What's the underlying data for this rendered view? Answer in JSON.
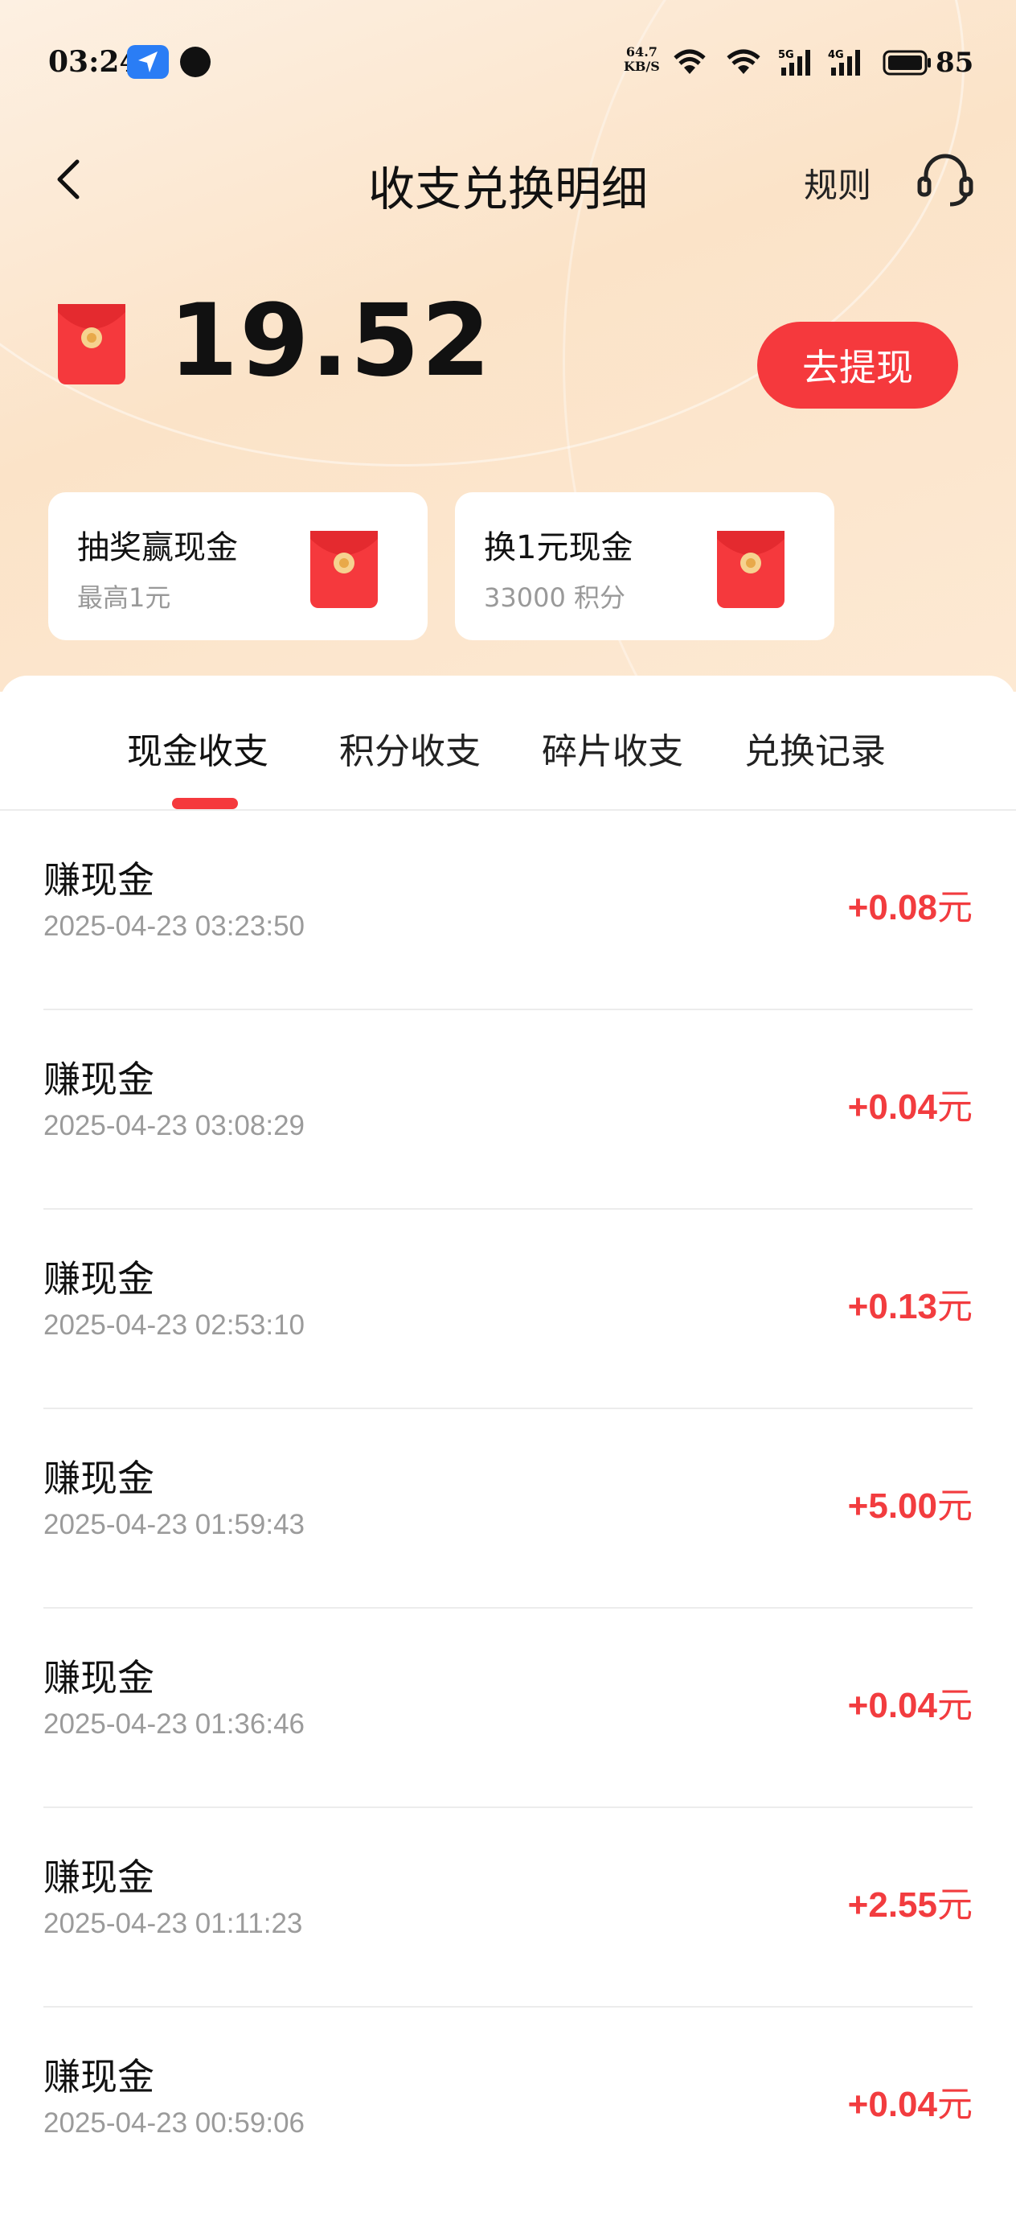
{
  "status_bar": {
    "time": "03:24",
    "net_speed_value": "64.7",
    "net_speed_unit": "KB/S",
    "sim1_label": "5G",
    "sim2_label": "4G",
    "battery": "85"
  },
  "header": {
    "title": "收支兑换明细",
    "rules_label": "规则"
  },
  "balance": {
    "amount": "19.52",
    "withdraw_label": "去提现"
  },
  "promos": [
    {
      "title": "抽奖赢现金",
      "subtitle": "最高1元"
    },
    {
      "title": "换1元现金",
      "subtitle": "33000 积分"
    }
  ],
  "tabs": [
    {
      "label": "现金收支",
      "active": true
    },
    {
      "label": "积分收支",
      "active": false
    },
    {
      "label": "碎片收支",
      "active": false
    },
    {
      "label": "兑换记录",
      "active": false
    }
  ],
  "transactions": [
    {
      "title": "赚现金",
      "time": "2025-04-23 03:23:50",
      "amount": "+0.08",
      "unit": "元"
    },
    {
      "title": "赚现金",
      "time": "2025-04-23 03:08:29",
      "amount": "+0.04",
      "unit": "元"
    },
    {
      "title": "赚现金",
      "time": "2025-04-23 02:53:10",
      "amount": "+0.13",
      "unit": "元"
    },
    {
      "title": "赚现金",
      "time": "2025-04-23 01:59:43",
      "amount": "+5.00",
      "unit": "元"
    },
    {
      "title": "赚现金",
      "time": "2025-04-23 01:36:46",
      "amount": "+0.04",
      "unit": "元"
    },
    {
      "title": "赚现金",
      "time": "2025-04-23 01:11:23",
      "amount": "+2.55",
      "unit": "元"
    },
    {
      "title": "赚现金",
      "time": "2025-04-23 00:59:06",
      "amount": "+0.04",
      "unit": "元"
    }
  ],
  "colors": {
    "accent_red": "#f5393d",
    "amount_red": "#f23c3f",
    "header_bg": "#fbe3c8",
    "location_badge": "#2a7df5"
  },
  "icons": [
    "location-arrow-icon",
    "chat-bubble-icon",
    "wifi-icon",
    "signal-icon",
    "battery-icon",
    "back-icon",
    "headset-icon",
    "red-envelope-icon"
  ]
}
